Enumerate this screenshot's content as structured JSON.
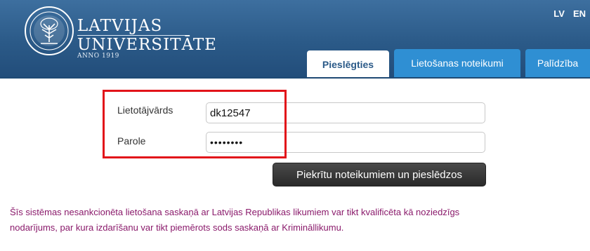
{
  "header": {
    "brand": {
      "line1": "LATVIJAS",
      "line2": "UNIVERSITĀTE",
      "year": "ANNO 1919"
    },
    "languages": [
      "LV",
      "EN"
    ]
  },
  "tabs": [
    {
      "label": "Pieslēgties",
      "active": true
    },
    {
      "label": "Lietošanas noteikumi",
      "active": false
    },
    {
      "label": "Palīdzība",
      "active": false
    }
  ],
  "form": {
    "username_label": "Lietotājvārds",
    "username_value": "dk12547",
    "password_label": "Parole",
    "password_value": "••••••••",
    "submit_label": "Piekrītu noteikumiem un pieslēdzos"
  },
  "notice": {
    "line1": "Šīs sistēmas nesankcionēta lietošana saskaņā ar Latvijas Republikas likumiem var tikt kvalificēta kā noziedzīgs",
    "line2": "nodarījums, par kura izdarīšanu var tikt piemērots sods saskaņā ar Krimināllikumu."
  },
  "colors": {
    "header_blue": "#2b5a88",
    "tab_blue": "#2f8fd3",
    "highlight_red": "#e2141a",
    "notice_text": "#8a1a6b"
  }
}
